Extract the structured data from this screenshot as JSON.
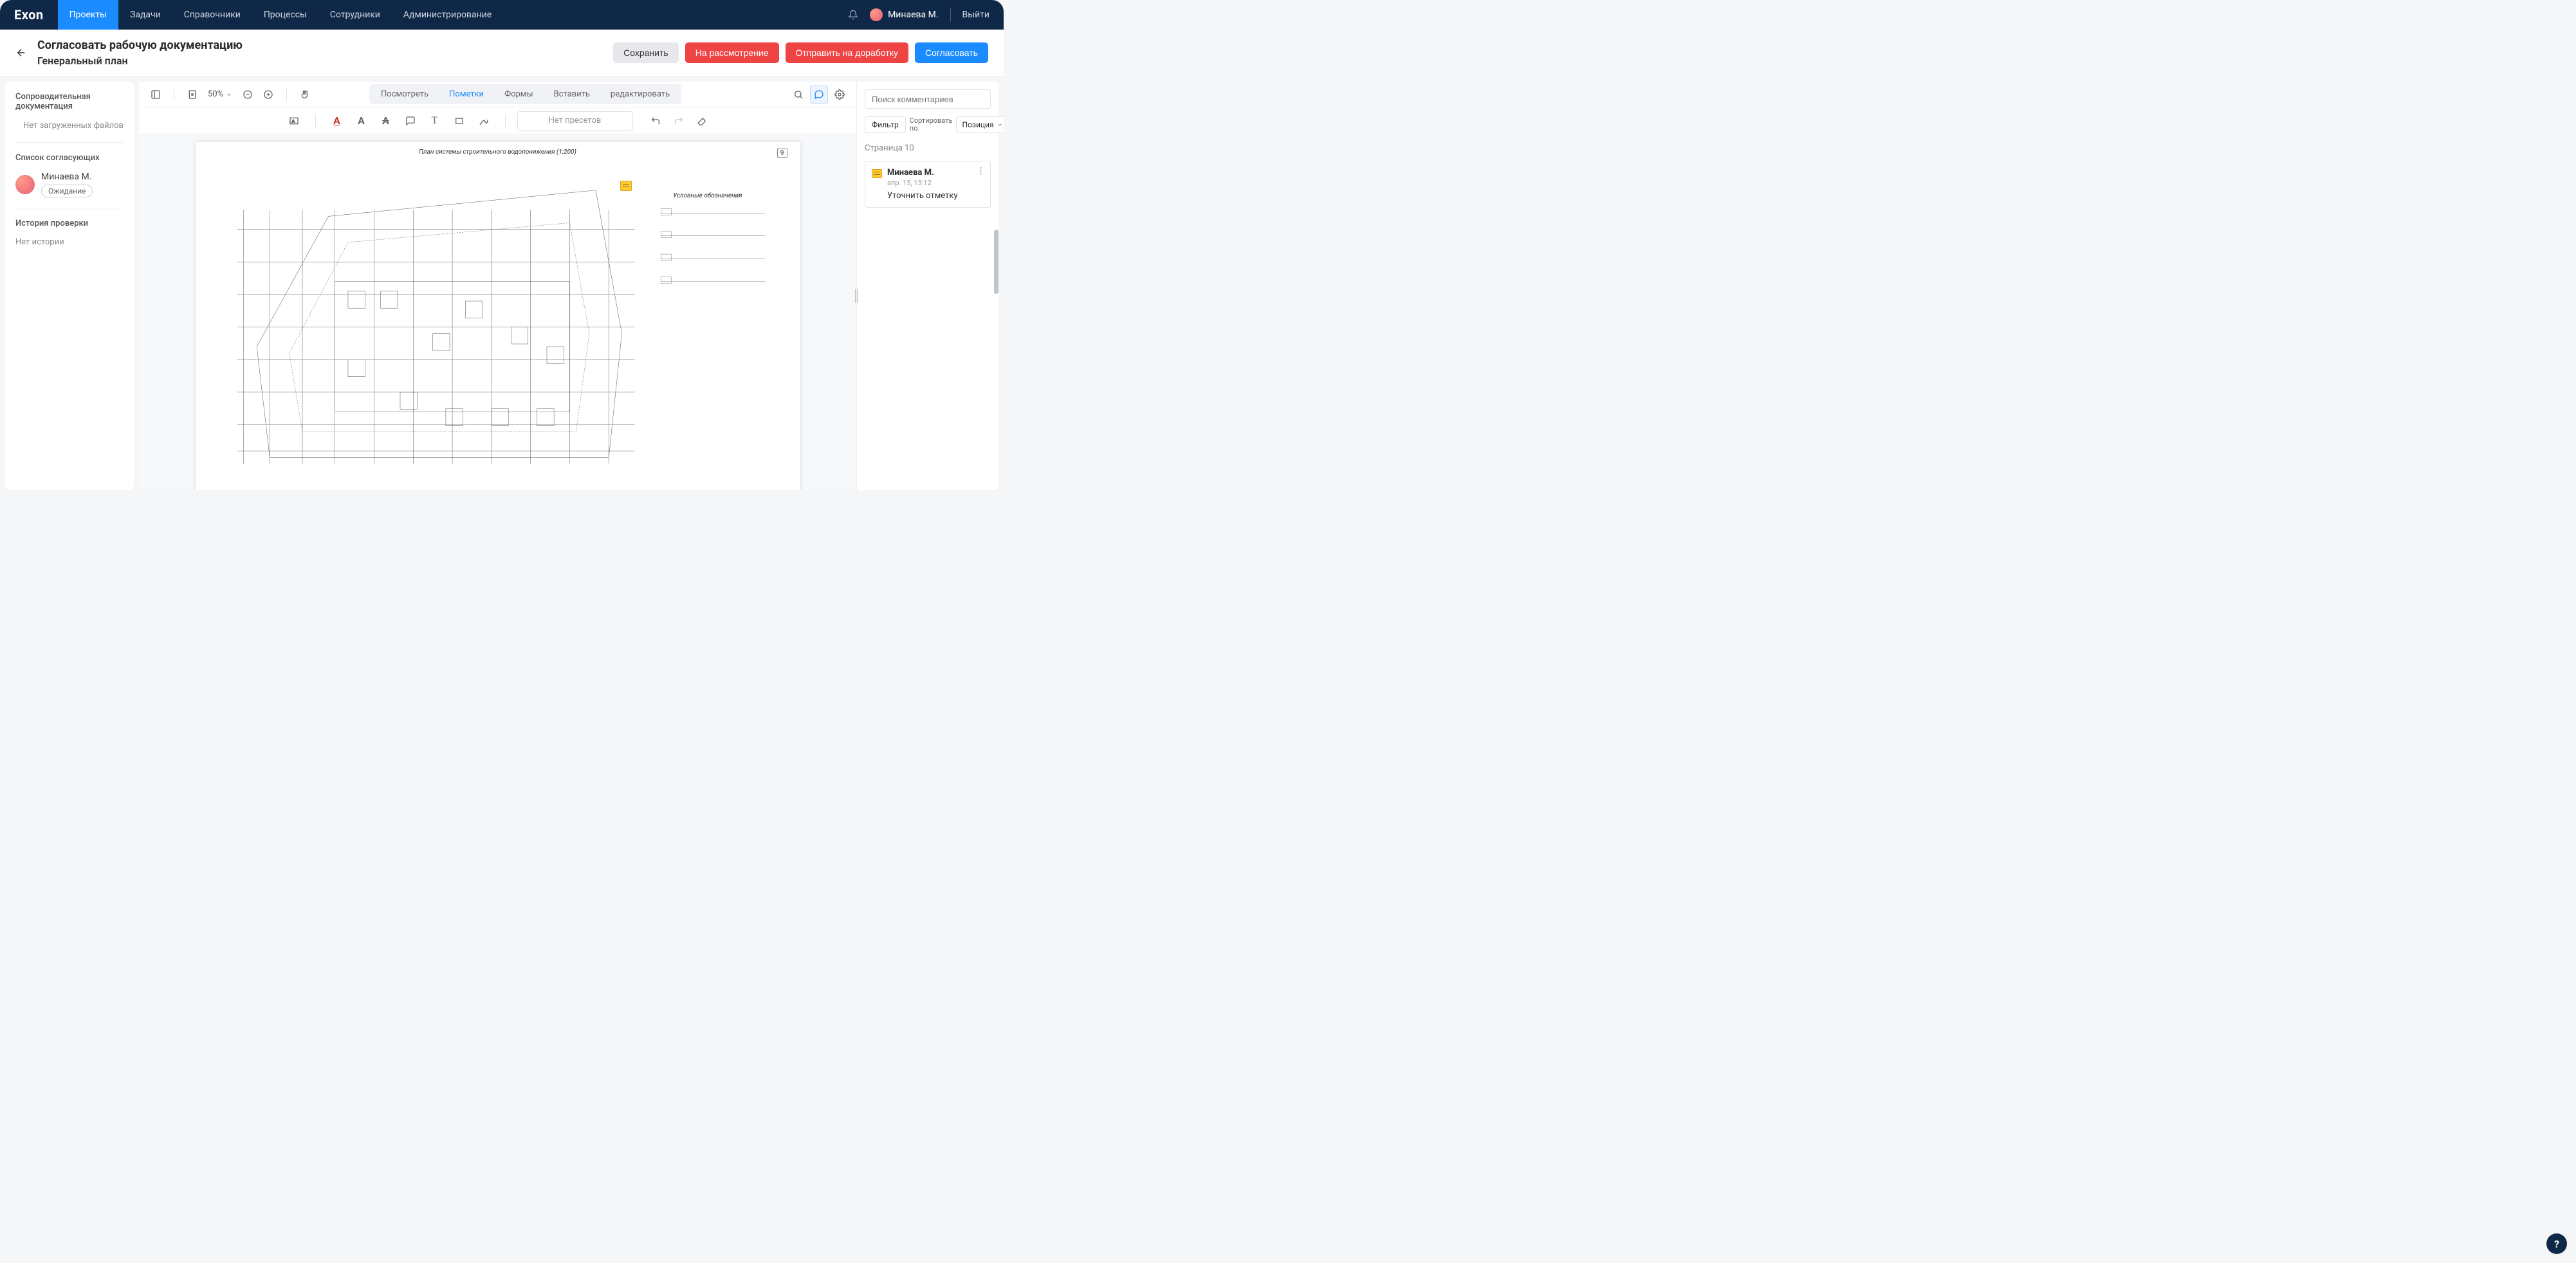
{
  "brand": "Exon",
  "nav": {
    "projects": "Проекты",
    "tasks": "Задачи",
    "refs": "Справочники",
    "processes": "Процессы",
    "employees": "Сотрудники",
    "admin": "Администрирование"
  },
  "user": {
    "name": "Минаева М.",
    "logout": "Выйти"
  },
  "page": {
    "title": "Согласовать рабочую документацию",
    "subtitle": "Генеральный план"
  },
  "actions": {
    "save": "Сохранить",
    "review": "На рассмотрение",
    "rework": "Отправить на доработку",
    "approve": "Согласовать"
  },
  "left": {
    "docs_title": "Сопроводительная документация",
    "no_files": "Нет загруженных файлов",
    "approvers_title": "Список согласующих",
    "approver_name": "Минаева М.",
    "approver_status": "Ожидание",
    "history_title": "История проверки",
    "no_history": "Нет истории"
  },
  "viewer": {
    "zoom": "50%",
    "tabs": {
      "view": "Посмотреть",
      "annot": "Пометки",
      "forms": "Формы",
      "insert": "Вставить",
      "edit": "редактировать"
    },
    "preset_placeholder": "Нет пресетов",
    "page_number": "9",
    "plan_title": "План системы строительного водопонижения (1:200)",
    "legend_title": "Условные обозначения"
  },
  "comments": {
    "search_placeholder": "Поиск комментариев",
    "filter": "Фильтр",
    "sort_label": "Сортировать по:",
    "sort_value": "Позиция",
    "page_label": "Страница 10",
    "card": {
      "author": "Минаева М.",
      "date": "апр. 15, 15:12",
      "text": "Уточнить отметку"
    }
  },
  "help": "?"
}
